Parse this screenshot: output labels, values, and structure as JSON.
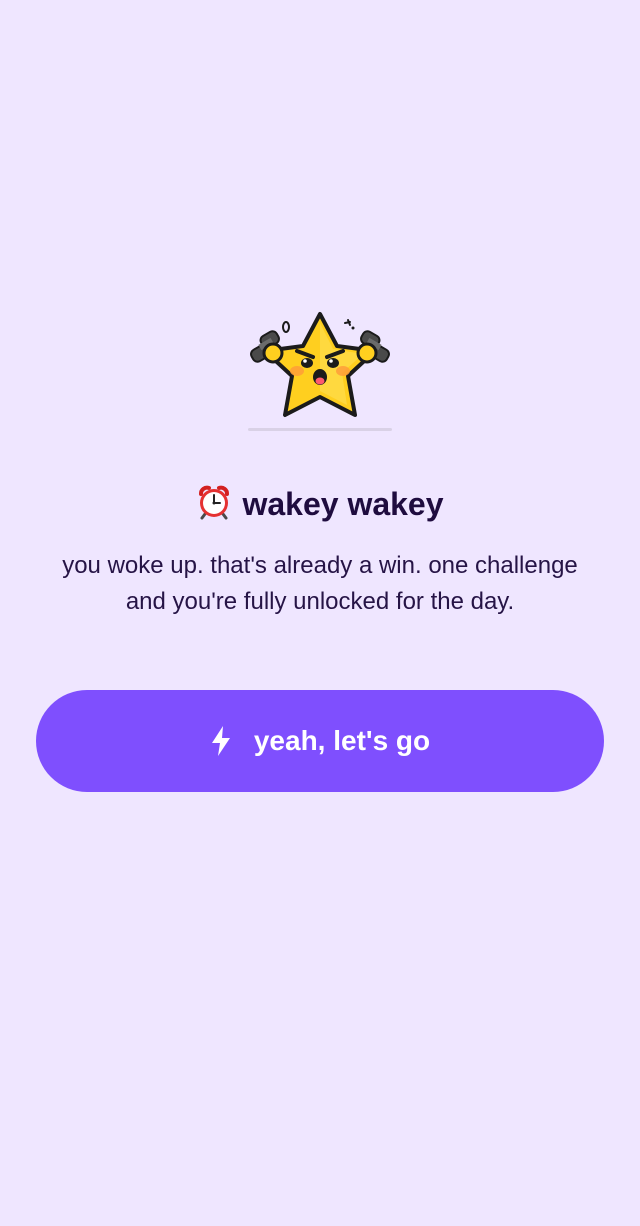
{
  "screen": {
    "mascot_icon": "angry-star-dumbbells-mascot",
    "title_icon": "alarm-clock-emoji",
    "title": "wakey wakey",
    "subtitle": "you woke up. that's already a win. one challenge and you're fully unlocked for the day."
  },
  "cta": {
    "icon": "lightning-bolt-icon",
    "label": "yeah, let's go"
  },
  "colors": {
    "background": "#efe6ff",
    "accent": "#7f4ffe",
    "text": "#1f0c3f",
    "button_text": "#ffffff",
    "mascot_yellow": "#ffcf1f"
  }
}
